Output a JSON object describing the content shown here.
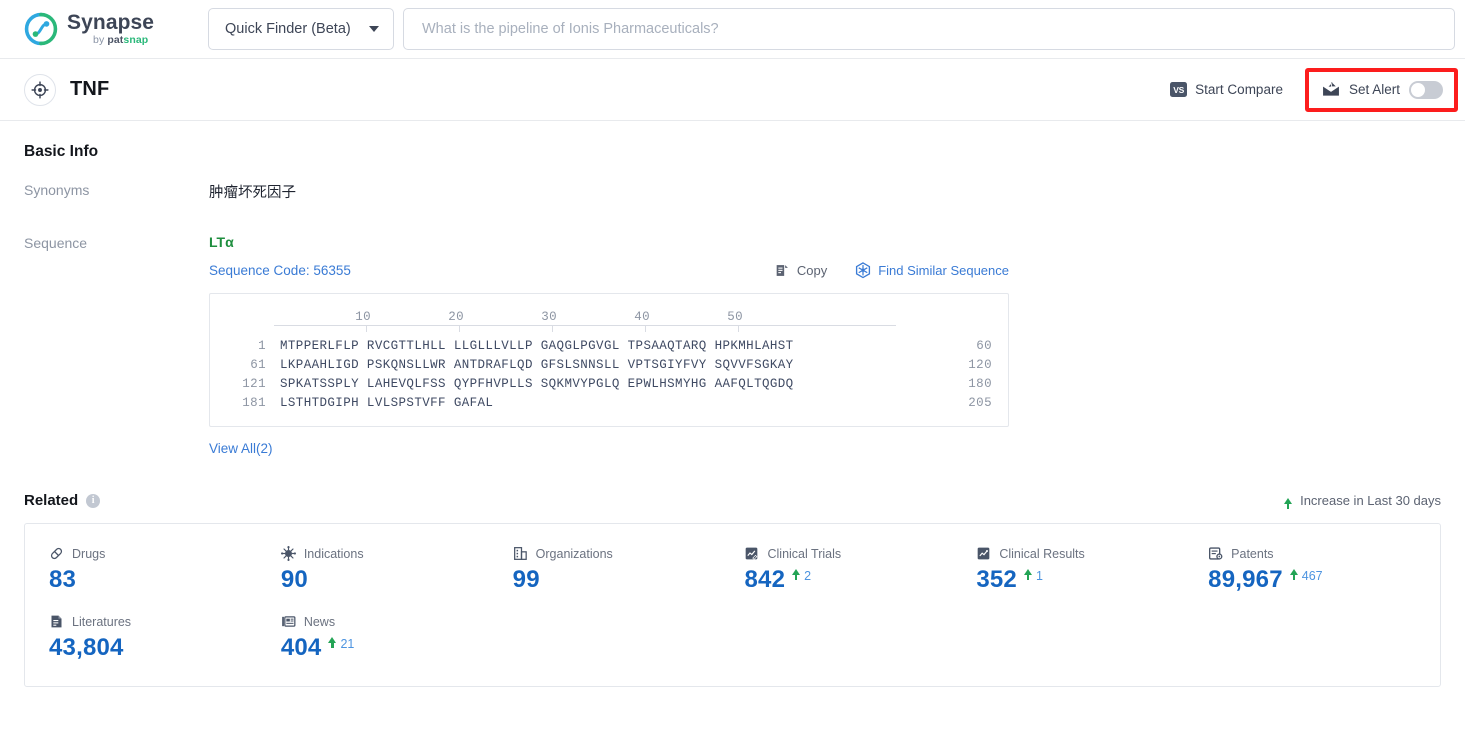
{
  "brand": {
    "name": "Synapse",
    "by": "by ",
    "pat": "pat",
    "snap": "snap",
    "logo_icon": "synapse-logo-icon"
  },
  "header": {
    "finder_label": "Quick Finder (Beta)",
    "finder_caret_icon": "chevron-down-icon",
    "search_placeholder": "What is the pipeline of Ionis Pharmaceuticals?",
    "search_value": ""
  },
  "titlebar": {
    "target_icon": "target-crosshair-icon",
    "title": "TNF",
    "start_compare_label": "Start Compare",
    "vs_icon_text": "VS",
    "set_alert_label": "Set Alert",
    "alert_icon": "mail-alert-icon",
    "alert_toggle_state": "off",
    "highlight_color": "#fc1d1d"
  },
  "basic_info": {
    "heading": "Basic Info",
    "rows": [
      {
        "label": "Synonyms",
        "value": "肿瘤坏死因子"
      },
      {
        "label": "Sequence",
        "value": ""
      }
    ]
  },
  "sequence": {
    "name": "LTα",
    "name_color": "#1e8e3e",
    "code_label": "Sequence Code: 56355",
    "copy_label": "Copy",
    "copy_icon": "copy-icon",
    "find_similar_label": "Find Similar Sequence",
    "find_similar_icon": "molecule-hex-icon",
    "ruler_ticks": [
      10,
      20,
      30,
      40,
      50
    ],
    "rows": [
      {
        "start": "1",
        "chunks": "MTPPERLFLP RVCGTTLHLL LLGLLLVLLP GAQGLPGVGL TPSAAQTARQ HPKMHLAHST",
        "end": "60"
      },
      {
        "start": "61",
        "chunks": "LKPAAHLIGD PSKQNSLLWR ANTDRAFLQD GFSLSNNSLL VPTSGIYFVY SQVVFSGKAY",
        "end": "120"
      },
      {
        "start": "121",
        "chunks": "SPKATSSPLY LAHEVQLFSS QYPFHVPLLS SQKMVYPGLQ EPWLHSMYHG AAFQLTQGDQ",
        "end": "180"
      },
      {
        "start": "181",
        "chunks": "LSTHTDGIPH LVLSPSTVFF GAFAL",
        "end": "205"
      }
    ],
    "view_all_label": "View All(2)"
  },
  "related": {
    "title": "Related",
    "info_icon": "info-icon",
    "info_glyph": "i",
    "legend_label": "Increase in Last 30 days",
    "legend_icon": "arrow-up-icon",
    "increase_color": "#23a455",
    "value_color": "#1565c0",
    "metrics": [
      {
        "label": "Drugs",
        "icon": "pill-icon",
        "value": "83",
        "delta": ""
      },
      {
        "label": "Indications",
        "icon": "virus-icon",
        "value": "90",
        "delta": ""
      },
      {
        "label": "Organizations",
        "icon": "building-icon",
        "value": "99",
        "delta": ""
      },
      {
        "label": "Clinical Trials",
        "icon": "clinical-trial-icon",
        "value": "842",
        "delta": "2"
      },
      {
        "label": "Clinical Results",
        "icon": "clinical-results-icon",
        "value": "352",
        "delta": "1"
      },
      {
        "label": "Patents",
        "icon": "patent-icon",
        "value": "89,967",
        "delta": "467"
      },
      {
        "label": "Literatures",
        "icon": "literature-icon",
        "value": "43,804",
        "delta": ""
      },
      {
        "label": "News",
        "icon": "news-icon",
        "value": "404",
        "delta": "21"
      }
    ]
  }
}
